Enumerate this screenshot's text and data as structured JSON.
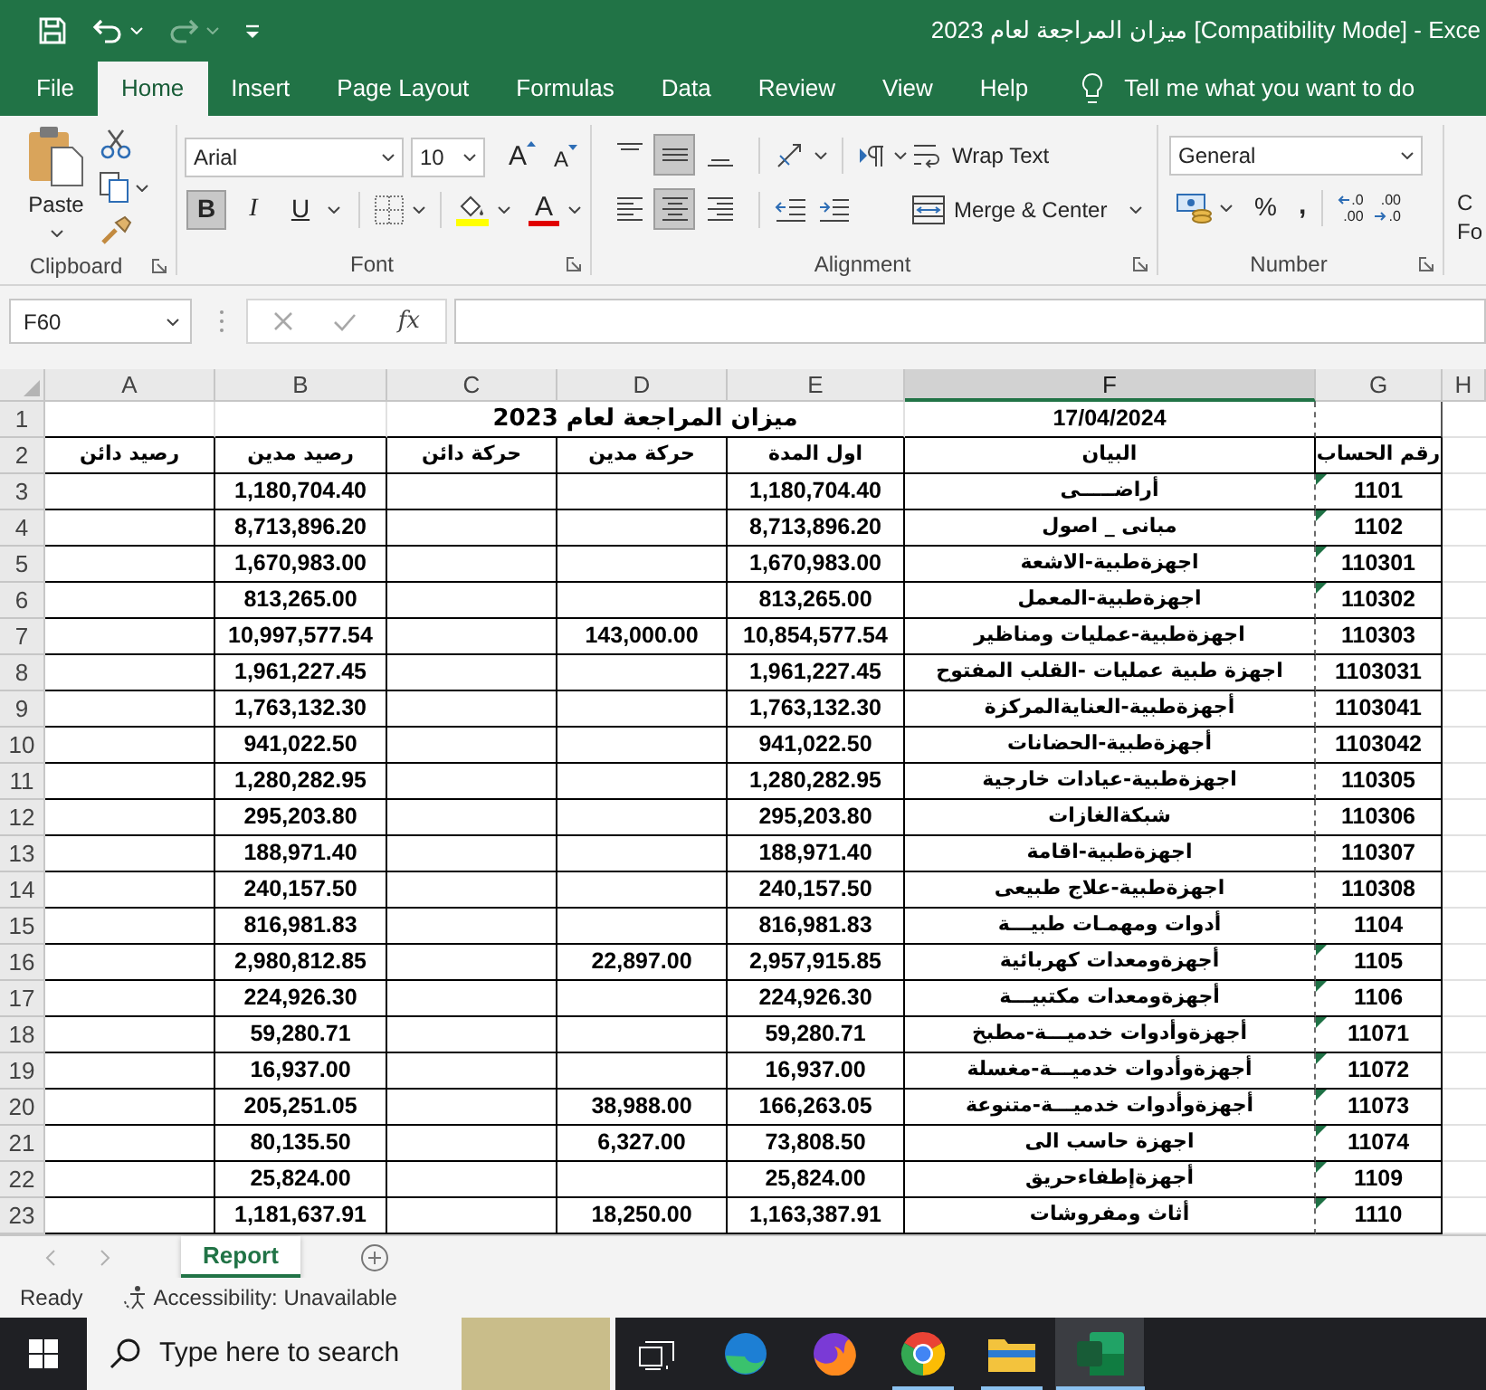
{
  "title_bar": {
    "quick_access": [
      {
        "kind": "save",
        "disabled": false
      },
      {
        "kind": "undo",
        "disabled": false
      },
      {
        "kind": "redo",
        "disabled": true
      },
      {
        "kind": "customize",
        "disabled": false
      }
    ],
    "title": "ميزان المراجعة لعام 2023 [Compatibility Mode] - Exce"
  },
  "menu_tabs": [
    {
      "label": "File",
      "selected": false
    },
    {
      "label": "Home",
      "selected": true
    },
    {
      "label": "Insert",
      "selected": false
    },
    {
      "label": "Page Layout",
      "selected": false
    },
    {
      "label": "Formulas",
      "selected": false
    },
    {
      "label": "Data",
      "selected": false
    },
    {
      "label": "Review",
      "selected": false
    },
    {
      "label": "View",
      "selected": false
    },
    {
      "label": "Help",
      "selected": false
    }
  ],
  "tell_me": {
    "label": "Tell me what you want to do"
  },
  "ribbon": {
    "clipboard": {
      "label": "Clipboard",
      "paste": "Paste"
    },
    "font": {
      "label": "Font",
      "font_name": "Arial",
      "font_size": "10",
      "grow": "A",
      "shrink": "A",
      "styles": [
        {
          "kind": "bold",
          "glyph": "B",
          "on": true
        },
        {
          "kind": "italic",
          "glyph": "I",
          "on": false
        },
        {
          "kind": "underline",
          "glyph": "U",
          "on": false
        }
      ],
      "font_color": "A"
    },
    "alignment": {
      "label": "Alignment",
      "vertical": [
        {
          "kind": "top",
          "selected": false
        },
        {
          "kind": "middle",
          "selected": true
        },
        {
          "kind": "bottom",
          "selected": false
        }
      ],
      "horizontal": [
        {
          "kind": "left",
          "selected": false
        },
        {
          "kind": "center",
          "selected": true
        },
        {
          "kind": "right",
          "selected": false
        }
      ],
      "wrap_text": "Wrap Text",
      "merge": "Merge & Center"
    },
    "number": {
      "label": "Number",
      "format": "General",
      "percent": "%",
      "comma": ",",
      "decimals": [
        {
          "kind": "increase",
          "top": ".0",
          "bottom": ".00"
        },
        {
          "kind": "decrease",
          "top": ".00",
          "bottom": ".0"
        }
      ]
    },
    "cut_off_group": {
      "line_1": "C",
      "line_2": "Fo"
    }
  },
  "formula_bar": {
    "name_box": "F60",
    "editing": false,
    "function_glyph": "fx"
  },
  "sheet": {
    "columns": [
      {
        "label": "A",
        "selected": false
      },
      {
        "label": "B",
        "selected": false
      },
      {
        "label": "C",
        "selected": false
      },
      {
        "label": "D",
        "selected": false
      },
      {
        "label": "E",
        "selected": false
      },
      {
        "label": "F",
        "selected": true
      },
      {
        "label": "G",
        "selected": false
      },
      {
        "label": "H",
        "selected": false
      }
    ],
    "title_row": {
      "row_label": "1",
      "title": "ميزان المراجعة لعام 2023",
      "date": "17/04/2024"
    },
    "header_row": {
      "row_label": "2",
      "headings": [
        "رقم الحساب",
        "البيان",
        "اول المدة",
        "حركة مدين",
        "حركة دائن",
        "رصيد مدين",
        "رصيد دائن"
      ]
    },
    "rows": [
      {
        "row_label": "3",
        "debit_balance": "1,180,704.40",
        "opening": "1,180,704.40",
        "description": "أراضـــــى",
        "account_no": "1101",
        "flagged": true
      },
      {
        "row_label": "4",
        "debit_balance": "8,713,896.20",
        "opening": "8,713,896.20",
        "description": "مبانى _ اصول",
        "account_no": "1102",
        "flagged": true
      },
      {
        "row_label": "5",
        "debit_balance": "1,670,983.00",
        "opening": "1,670,983.00",
        "description": "اجهزةطبية-الاشعة",
        "account_no": "110301",
        "flagged": true
      },
      {
        "row_label": "6",
        "debit_balance": "813,265.00",
        "opening": "813,265.00",
        "description": "اجهزةطبية-المعمل",
        "account_no": "110302",
        "flagged": true
      },
      {
        "row_label": "7",
        "debit_balance": "10,997,577.54",
        "debit_movement": "143,000.00",
        "opening": "10,854,577.54",
        "description": "اجهزةطبية-عمليات ومناظير",
        "account_no": "110303",
        "flagged": false
      },
      {
        "row_label": "8",
        "debit_balance": "1,961,227.45",
        "opening": "1,961,227.45",
        "description": "اجهزة طبية عمليات -القلب المفتوح",
        "account_no": "1103031",
        "flagged": false
      },
      {
        "row_label": "9",
        "debit_balance": "1,763,132.30",
        "opening": "1,763,132.30",
        "description": "أجهزةطبية-العنايةالمركزة",
        "account_no": "1103041",
        "flagged": false
      },
      {
        "row_label": "10",
        "debit_balance": "941,022.50",
        "opening": "941,022.50",
        "description": "أجهزةطبية-الحضانات",
        "account_no": "1103042",
        "flagged": false
      },
      {
        "row_label": "11",
        "debit_balance": "1,280,282.95",
        "opening": "1,280,282.95",
        "description": "اجهزةطبية-عيادات خارجية",
        "account_no": "110305",
        "flagged": false
      },
      {
        "row_label": "12",
        "debit_balance": "295,203.80",
        "opening": "295,203.80",
        "description": "شبكةالغازات",
        "account_no": "110306",
        "flagged": false
      },
      {
        "row_label": "13",
        "debit_balance": "188,971.40",
        "opening": "188,971.40",
        "description": "اجهزةطبية-اقامة",
        "account_no": "110307",
        "flagged": false
      },
      {
        "row_label": "14",
        "debit_balance": "240,157.50",
        "opening": "240,157.50",
        "description": "اجهزةطبية-علاج طبيعى",
        "account_no": "110308",
        "flagged": false
      },
      {
        "row_label": "15",
        "debit_balance": "816,981.83",
        "opening": "816,981.83",
        "description": "أدوات ومهمـات طبيـــة",
        "account_no": "1104",
        "flagged": false
      },
      {
        "row_label": "16",
        "debit_balance": "2,980,812.85",
        "debit_movement": "22,897.00",
        "opening": "2,957,915.85",
        "description": "أجهزةومعدات كهربائية",
        "account_no": "1105",
        "flagged": true
      },
      {
        "row_label": "17",
        "debit_balance": "224,926.30",
        "opening": "224,926.30",
        "description": "أجهزةومعدات مكتبيـــة",
        "account_no": "1106",
        "flagged": true
      },
      {
        "row_label": "18",
        "debit_balance": "59,280.71",
        "opening": "59,280.71",
        "description": "أجهزةوأدوات خدميـــة-مطبخ",
        "account_no": "11071",
        "flagged": true
      },
      {
        "row_label": "19",
        "debit_balance": "16,937.00",
        "opening": "16,937.00",
        "description": "أجهزةوأدوات خدميـــة-مغسلة",
        "account_no": "11072",
        "flagged": true
      },
      {
        "row_label": "20",
        "debit_balance": "205,251.05",
        "debit_movement": "38,988.00",
        "opening": "166,263.05",
        "description": "أجهزةوأدوات خدميـــة-متنوعة",
        "account_no": "11073",
        "flagged": true
      },
      {
        "row_label": "21",
        "debit_balance": "80,135.50",
        "debit_movement": "6,327.00",
        "opening": "73,808.50",
        "description": "اجهزة حاسب الى",
        "account_no": "11074",
        "flagged": true
      },
      {
        "row_label": "22",
        "debit_balance": "25,824.00",
        "opening": "25,824.00",
        "description": "أجهزةإطفاءحريق",
        "account_no": "1109",
        "flagged": true
      },
      {
        "row_label": "23",
        "debit_balance": "1,181,637.91",
        "debit_movement": "18,250.00",
        "opening": "1,163,387.91",
        "description": "أثاث ومفروشات",
        "account_no": "1110",
        "flagged": true
      }
    ]
  },
  "sheet_tabs": [
    {
      "label": "Report",
      "selected": true
    }
  ],
  "status_bar": {
    "mode": "Ready",
    "accessibility": "Accessibility: Unavailable"
  },
  "taskbar": {
    "search_placeholder": "Type here to search",
    "apps": [
      {
        "kind": "task_view",
        "running": false,
        "active": false
      },
      {
        "kind": "edge",
        "running": false,
        "active": false
      },
      {
        "kind": "firefox",
        "running": false,
        "active": false
      },
      {
        "kind": "chrome",
        "running": true,
        "active": false
      },
      {
        "kind": "explorer",
        "running": true,
        "active": false
      },
      {
        "kind": "excel",
        "running": true,
        "active": true
      }
    ]
  }
}
